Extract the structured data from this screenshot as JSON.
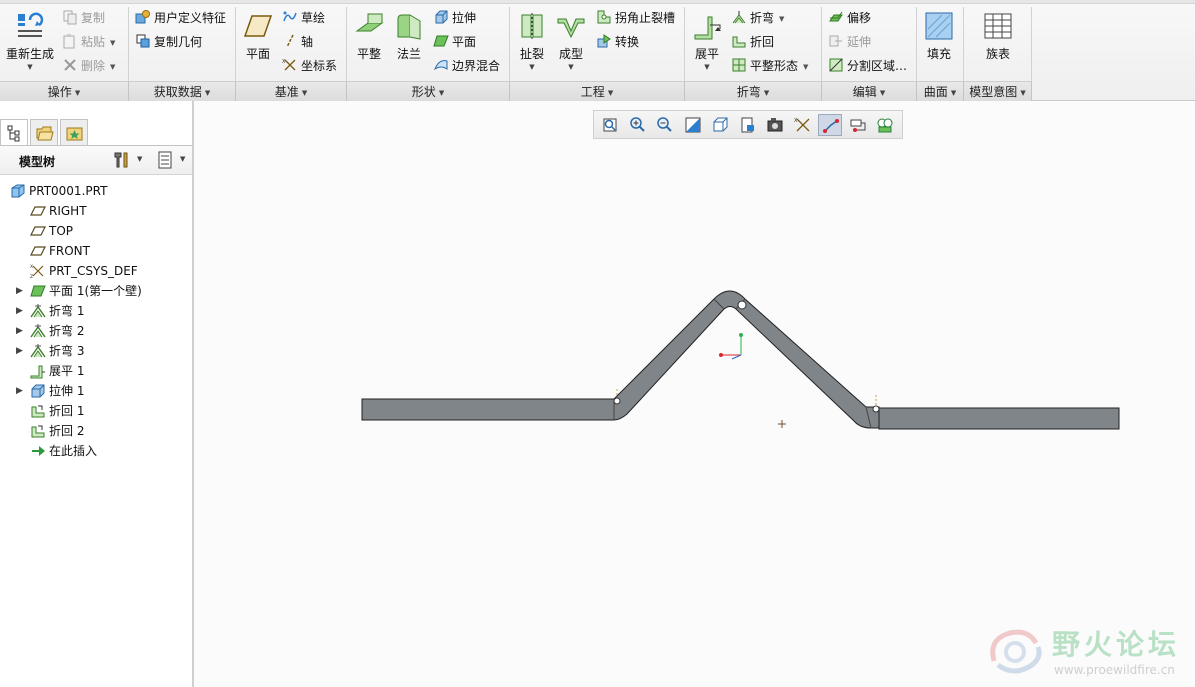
{
  "ribbon": {
    "operations": {
      "regenerate": "重新生成",
      "copy": "复制",
      "paste": "粘贴",
      "delete": "删除",
      "label": "操作"
    },
    "get_data": {
      "udf": "用户定义特征",
      "copy_geometry": "复制几何",
      "label": "获取数据"
    },
    "datum": {
      "plane": "平面",
      "sketch": "草绘",
      "axis": "轴",
      "csys": "坐标系",
      "label": "基准"
    },
    "shapes": {
      "flat": "平整",
      "flange": "法兰",
      "extrude": "拉伸",
      "planar": "平面",
      "blend": "边界混合",
      "label": "形状"
    },
    "engineering": {
      "rip": "扯裂",
      "form": "成型",
      "corner_relief": "拐角止裂槽",
      "convert": "转换",
      "label": "工程"
    },
    "bend": {
      "unbend": "展平",
      "bend": "折弯",
      "bend_back": "折回",
      "flat_state": "平整形态",
      "label": "折弯"
    },
    "editing": {
      "offset": "偏移",
      "extend": "延伸",
      "split_area": "分割区域…",
      "label": "编辑"
    },
    "surfaces": {
      "fill": "填充",
      "label": "曲面"
    },
    "model_intent": {
      "family_table": "族表",
      "label": "模型意图"
    }
  },
  "panel": {
    "title": "模型树",
    "items": [
      {
        "label": "PRT0001.PRT",
        "icon": "part-icon",
        "expandable": false
      },
      {
        "label": "RIGHT",
        "icon": "datum-plane-icon",
        "expandable": false
      },
      {
        "label": "TOP",
        "icon": "datum-plane-icon",
        "expandable": false
      },
      {
        "label": "FRONT",
        "icon": "datum-plane-icon",
        "expandable": false
      },
      {
        "label": "PRT_CSYS_DEF",
        "icon": "csys-icon",
        "expandable": false
      },
      {
        "label": "平面 1(第一个壁)",
        "icon": "planar-wall-icon",
        "expandable": true
      },
      {
        "label": "折弯 1",
        "icon": "bend-icon",
        "expandable": true
      },
      {
        "label": "折弯 2",
        "icon": "bend-icon",
        "expandable": true
      },
      {
        "label": "折弯 3",
        "icon": "bend-icon",
        "expandable": true
      },
      {
        "label": "展平 1",
        "icon": "unbend-icon",
        "expandable": false
      },
      {
        "label": "拉伸 1",
        "icon": "extrude-icon",
        "expandable": true
      },
      {
        "label": "折回 1",
        "icon": "bend-back-icon",
        "expandable": false
      },
      {
        "label": "折回 2",
        "icon": "bend-back-icon",
        "expandable": false
      },
      {
        "label": "在此插入",
        "icon": "insert-here-icon",
        "expandable": false
      }
    ]
  },
  "viewbar": {
    "buttons": [
      "refit-icon",
      "zoom-in-icon",
      "zoom-out-icon",
      "repaint-icon",
      "display-style-icon",
      "saved-views-icon",
      "view-manager-icon",
      "datum-display-icon",
      "spin-center-icon",
      "annotation-display-icon",
      "appearance-icon"
    ]
  },
  "watermark": {
    "title": "野火论坛",
    "url": "www.proewildfire.cn"
  },
  "colors": {
    "part_fill": "#808589",
    "ribbon_bg": "#f2f2f2",
    "accent_blue": "#2a7fd0",
    "feature_green": "#5b9b3e"
  }
}
